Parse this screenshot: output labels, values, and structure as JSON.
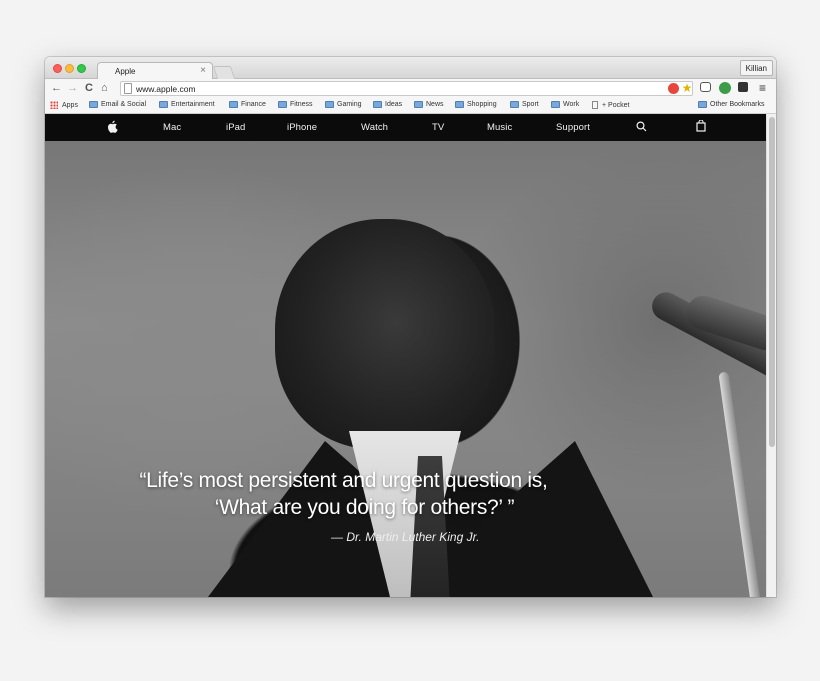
{
  "tab": {
    "title": "Apple",
    "icon": "apple-icon",
    "close": "×"
  },
  "profile": "Killian",
  "toolbar": {
    "back": "←",
    "forward": "→",
    "reload": "C",
    "home": "⌂",
    "url": "www.apple.com"
  },
  "bookmarks": [
    {
      "label": "Apps",
      "icon": "apps-grid-icon"
    },
    {
      "label": "Email & Social",
      "icon": "folder-icon"
    },
    {
      "label": "Entertainment",
      "icon": "folder-icon"
    },
    {
      "label": "Finance",
      "icon": "folder-icon"
    },
    {
      "label": "Fitness",
      "icon": "folder-icon"
    },
    {
      "label": "Gaming",
      "icon": "folder-icon"
    },
    {
      "label": "Ideas",
      "icon": "folder-icon"
    },
    {
      "label": "News",
      "icon": "folder-icon"
    },
    {
      "label": "Shopping",
      "icon": "folder-icon"
    },
    {
      "label": "Sport",
      "icon": "folder-icon"
    },
    {
      "label": "Work",
      "icon": "folder-icon"
    },
    {
      "label": "+ Pocket",
      "icon": "page-icon"
    },
    {
      "label": "Other Bookmarks",
      "icon": "folder-icon"
    }
  ],
  "nav": {
    "logo": "",
    "items": [
      "Mac",
      "iPad",
      "iPhone",
      "Watch",
      "TV",
      "Music",
      "Support"
    ]
  },
  "hero": {
    "quote_line1": "“Life’s most persistent and urgent question is,",
    "quote_line2": "‘What are you doing for others?’ ”",
    "attribution": "— Dr. Martin Luther King Jr."
  },
  "colors": {
    "nav_bg": "#0b0b0b",
    "close": "#fc605c",
    "minimize": "#fdbc40",
    "maximize": "#34c84a"
  }
}
